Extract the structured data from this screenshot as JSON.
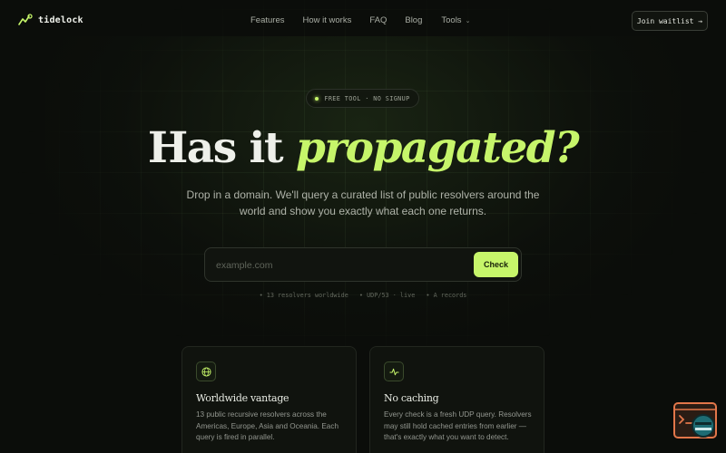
{
  "brand": {
    "name": "tidelock"
  },
  "nav": {
    "links": [
      "Features",
      "How it works",
      "FAQ",
      "Blog",
      "Tools"
    ],
    "cta": "Join waitlist →"
  },
  "hero": {
    "badge": "FREE TOOL · NO SIGNUP",
    "headline_plain": "Has it ",
    "headline_accent": "propagated?",
    "subtext": "Drop in a domain. We'll query a curated list of public resolvers around the world and show you exactly what each one returns.",
    "search": {
      "placeholder": "example.com",
      "value": "",
      "button": "Check"
    },
    "meta": [
      "• 13 resolvers worldwide",
      "• UDP/53 · live",
      "• A records"
    ]
  },
  "cards": [
    {
      "icon": "globe-icon",
      "title": "Worldwide vantage",
      "body": "13 public recursive resolvers across the Americas, Europe, Asia and Oceania. Each query is fired in parallel."
    },
    {
      "icon": "activity-icon",
      "title": "No caching",
      "body": "Every check is a fresh UDP query. Resolvers may still hold cached entries from earlier — that's exactly what you want to detect."
    }
  ],
  "colors": {
    "accent": "#c6f56a",
    "background": "#0b0d0a",
    "widget": "#e2764a"
  }
}
